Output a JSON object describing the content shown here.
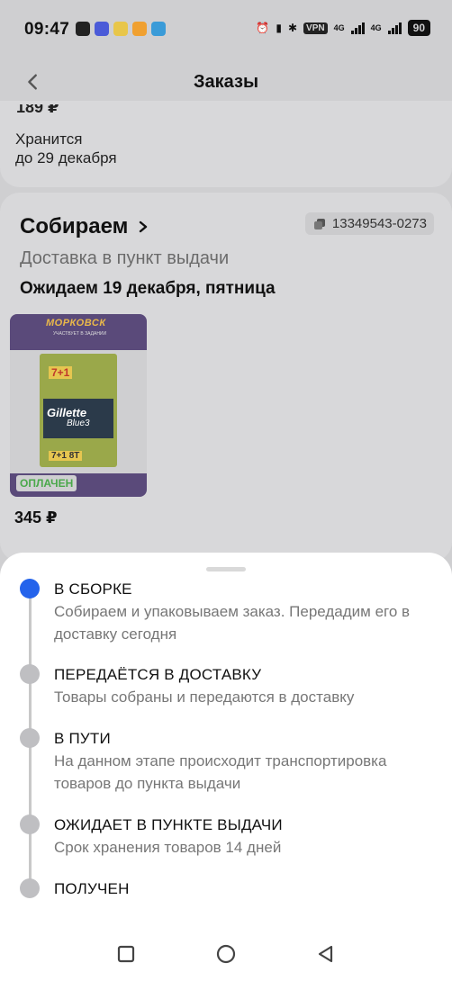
{
  "status_bar": {
    "time": "09:47",
    "network_label_1": "4G",
    "network_label_2": "4G",
    "vpn_label": "VPN",
    "battery": "90"
  },
  "header": {
    "title": "Заказы"
  },
  "previous_order": {
    "price_partial": "189 ₽",
    "storage_line1": "Хранится",
    "storage_line2": "до 29 декабря"
  },
  "order": {
    "status": "Собираем",
    "number": "13349543-0273",
    "delivery_type": "Доставка в пункт выдачи",
    "expected": "Ожидаем 19 декабря, пятница",
    "product": {
      "promo_logo": "МОРКОВСК",
      "promo_sub": "УЧАСТВУЕТ В ЗАДАНИИ",
      "brand": "Gillette",
      "model": "Blue3",
      "promo_top": "7+1",
      "promo_bottom": "7+1 8T",
      "paid_badge": "ОПЛАЧЕН"
    },
    "price": "345 ₽"
  },
  "timeline": {
    "steps": [
      {
        "title": "В СБОРКЕ",
        "desc": "Собираем и упаковываем заказ. Передадим его в доставку сегодня",
        "active": true
      },
      {
        "title": "ПЕРЕДАЁТСЯ В ДОСТАВКУ",
        "desc": "Товары собраны и передаются в доставку",
        "active": false
      },
      {
        "title": "В ПУТИ",
        "desc": "На данном этапе происходит транспортировка товаров до пункта выдачи",
        "active": false
      },
      {
        "title": "ОЖИДАЕТ В ПУНКТЕ ВЫДАЧИ",
        "desc": "Срок хранения товаров 14 дней",
        "active": false
      },
      {
        "title": "ПОЛУЧЕН",
        "desc": "",
        "active": false
      }
    ]
  },
  "colors": {
    "active_dot": "#2463eb",
    "inactive_dot": "#bfbfc2",
    "paid_badge": "#4aa84a"
  },
  "icons": {
    "back": "chevron-left-icon",
    "status_chevron": "chevron-right-icon",
    "order_number": "copy-icon",
    "nav_recent": "square-icon",
    "nav_home": "circle-icon",
    "nav_back": "triangle-back-icon"
  }
}
